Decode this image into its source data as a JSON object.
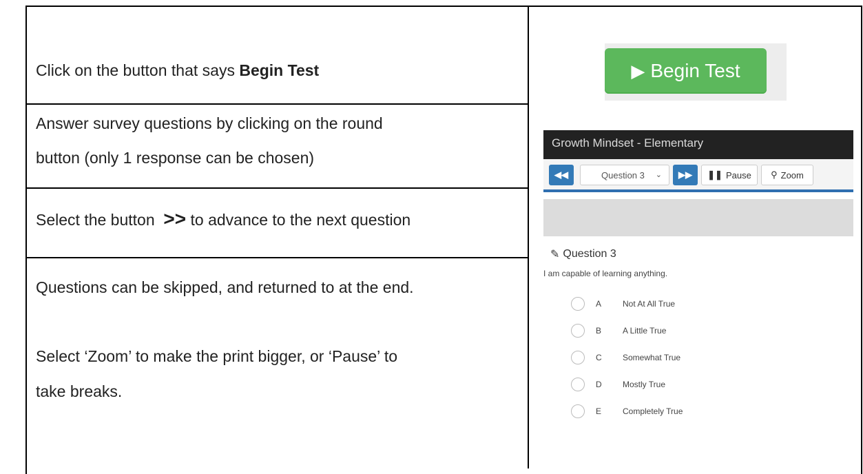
{
  "instructions": {
    "row1_prefix": "Click on the button that says ",
    "row1_bold": "Begin Test",
    "row2_line1": "Answer survey questions by clicking on the round",
    "row2_line2": "button (only 1 response can be chosen)",
    "row3_prefix": "Select the button ",
    "row3_bold": ">>",
    "row3_suffix": " to advance to the next question",
    "row4_line1": "Questions can be skipped, and returned to at the end.",
    "row4_line2": "Select ‘Zoom’ to make the print bigger, or ‘Pause’ to",
    "row4_line3": "take breaks."
  },
  "begin_button": {
    "label": "Begin Test",
    "color": "#5cb85c"
  },
  "test_ui": {
    "title": "Growth Mindset - Elementary",
    "toolbar": {
      "question_select": "Question 3",
      "pause_label": "Pause",
      "zoom_label": "Zoom",
      "accent_color": "#337ab7"
    },
    "question": {
      "heading": "Question 3",
      "text": "I am capable of learning anything.",
      "options": [
        {
          "letter": "A",
          "label": "Not At All True"
        },
        {
          "letter": "B",
          "label": "A Little True"
        },
        {
          "letter": "C",
          "label": "Somewhat True"
        },
        {
          "letter": "D",
          "label": "Mostly True"
        },
        {
          "letter": "E",
          "label": "Completely True"
        }
      ]
    }
  }
}
